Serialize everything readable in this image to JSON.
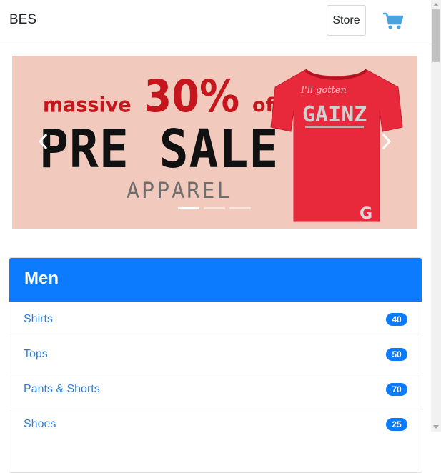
{
  "navbar": {
    "brand": "BES",
    "store_label": "Store",
    "cart_icon": "shopping-cart-icon"
  },
  "carousel": {
    "slide": {
      "massive": "massive",
      "percent": "30%",
      "off": "off",
      "headline": "PRE SALE",
      "subline": "APPAREL",
      "shirt_text": "GAINZ",
      "shirt_script": "I'll gotten"
    },
    "indicators": 3,
    "active_indicator": 0
  },
  "category": {
    "title": "Men",
    "items": [
      {
        "label": "Shirts",
        "count": "40"
      },
      {
        "label": "Tops",
        "count": "50"
      },
      {
        "label": "Pants & Shorts",
        "count": "70"
      },
      {
        "label": "Shoes",
        "count": "25"
      }
    ]
  },
  "colors": {
    "primary": "#0d7bfe",
    "cart": "#4aa3df",
    "banner_bg": "#f2cabd",
    "banner_red": "#c4161c",
    "shirt": "#e8293b"
  }
}
